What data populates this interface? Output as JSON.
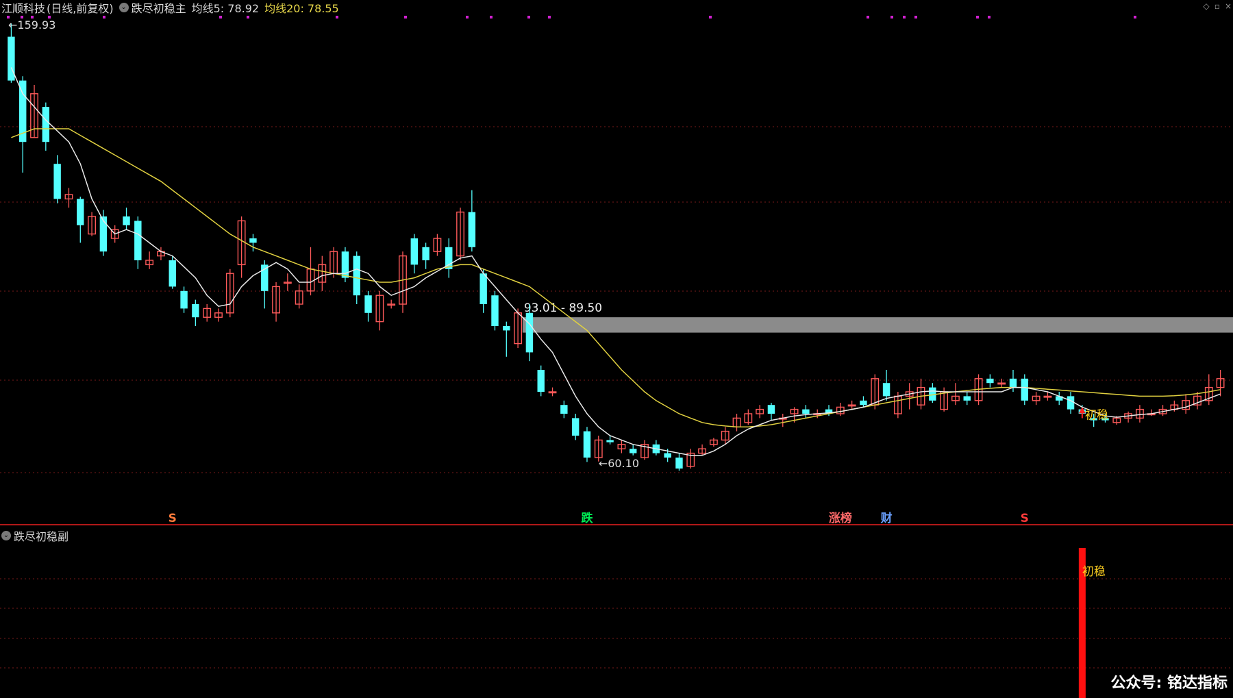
{
  "header": {
    "stock_name": "江顺科技",
    "period": "(日线,前复权)",
    "indicator_main": "跌尽初稳主",
    "ma5_label": "均线5: 78.92",
    "ma20_label": "均线20: 78.55"
  },
  "sub_header": {
    "indicator_sub": "跌尽初稳副"
  },
  "watermark": "公众号:  铭达指标",
  "colors": {
    "up": "#ff5a5a",
    "down": "#54ffff",
    "ma5": "#e8e8e8",
    "ma20": "#e0d040",
    "grid": "#7a1a1a",
    "zone": "#9a9a9a",
    "signal_dots": "#d020d0",
    "sub_bar": "#ff1010"
  },
  "icons": [
    "collapse-circle-icon",
    "diamond-icon",
    "window-icon",
    "close-icon"
  ],
  "chart_data": {
    "type": "candlestick",
    "price_range": [
      56,
      161
    ],
    "candles": [
      [
        157.0,
        147.0,
        160.0,
        146.5
      ],
      [
        147.0,
        133.0,
        148.0,
        126.0
      ],
      [
        134.0,
        144.0,
        146.0,
        134.0
      ],
      [
        141.0,
        133.0,
        142.0,
        131.0
      ],
      [
        128.0,
        120.0,
        130.0,
        119.0
      ],
      [
        120.0,
        121.0,
        122.5,
        118.0
      ],
      [
        120.0,
        114.0,
        120.5,
        110.0
      ],
      [
        112.0,
        116.0,
        117.0,
        111.5
      ],
      [
        116.0,
        108.0,
        117.5,
        107.0
      ],
      [
        111.0,
        113.0,
        114.0,
        110.0
      ],
      [
        116.0,
        114.0,
        118.0,
        113.0
      ],
      [
        115.0,
        106.0,
        116.0,
        104.0
      ],
      [
        105.0,
        106.0,
        108.0,
        104.0
      ],
      [
        107.0,
        108.0,
        109.0,
        106.0
      ],
      [
        106.0,
        100.0,
        107.0,
        99.5
      ],
      [
        99.0,
        95.0,
        100.0,
        94.0
      ],
      [
        96.0,
        93.0,
        97.0,
        91.0
      ],
      [
        93.0,
        95.0,
        96.0,
        92.0
      ],
      [
        93.0,
        94.0,
        95.0,
        92.0
      ],
      [
        94.0,
        103.0,
        104.0,
        93.0
      ],
      [
        105.0,
        115.0,
        116.0,
        102.0
      ],
      [
        111.0,
        110.0,
        112.0,
        108.0
      ],
      [
        105.0,
        99.0,
        106.0,
        95.0
      ],
      [
        94.0,
        100.0,
        101.0,
        92.0
      ],
      [
        101.0,
        101.0,
        103.0,
        99.0
      ],
      [
        96.0,
        99.0,
        100.5,
        95.0
      ],
      [
        99.0,
        104.0,
        109.0,
        98.0
      ],
      [
        101.0,
        105.0,
        107.0,
        99.0
      ],
      [
        103.0,
        108.0,
        109.0,
        102.0
      ],
      [
        108.0,
        102.0,
        109.0,
        101.0
      ],
      [
        107.0,
        98.0,
        108.0,
        96.0
      ],
      [
        98.0,
        94.0,
        99.0,
        92.0
      ],
      [
        92.0,
        98.0,
        99.0,
        90.0
      ],
      [
        96.0,
        96.0,
        97.0,
        95.0
      ],
      [
        96.0,
        107.0,
        108.0,
        94.0
      ],
      [
        111.0,
        105.0,
        112.0,
        103.0
      ],
      [
        109.0,
        106.0,
        110.0,
        104.0
      ],
      [
        108.0,
        111.0,
        112.0,
        107.0
      ],
      [
        109.0,
        104.0,
        111.0,
        102.0
      ],
      [
        107.0,
        117.0,
        118.0,
        106.0
      ],
      [
        117.0,
        109.0,
        122.0,
        108.0
      ],
      [
        103.0,
        96.0,
        104.0,
        94.0
      ],
      [
        98.0,
        91.0,
        99.0,
        90.0
      ],
      [
        91.0,
        90.0,
        92.0,
        84.0
      ],
      [
        87.0,
        94.0,
        95.0,
        86.0
      ],
      [
        94.0,
        85.0,
        96.0,
        83.0
      ],
      [
        81.0,
        76.0,
        82.0,
        75.0
      ],
      [
        76.0,
        76.0,
        77.0,
        75.0
      ],
      [
        73.0,
        71.0,
        74.0,
        70.0
      ],
      [
        70.0,
        66.0,
        71.0,
        65.0
      ],
      [
        67.0,
        61.0,
        68.0,
        60.0
      ],
      [
        61.0,
        65.0,
        66.0,
        60.1
      ],
      [
        65.0,
        64.5,
        66.0,
        64.0
      ],
      [
        63.0,
        64.0,
        65.0,
        62.0
      ],
      [
        63.0,
        62.0,
        64.0,
        61.5
      ],
      [
        61.0,
        64.0,
        65.0,
        60.5
      ],
      [
        64.0,
        62.0,
        65.0,
        61.5
      ],
      [
        62.0,
        61.0,
        63.0,
        60.0
      ],
      [
        61.0,
        58.5,
        62.0,
        58.0
      ],
      [
        59.0,
        62.0,
        63.0,
        58.5
      ],
      [
        62.0,
        63.0,
        64.0,
        61.5
      ],
      [
        64.0,
        65.0,
        65.5,
        63.5
      ],
      [
        65.0,
        67.0,
        68.0,
        64.0
      ],
      [
        68.0,
        70.0,
        71.0,
        67.0
      ],
      [
        69.0,
        71.0,
        72.0,
        68.5
      ],
      [
        71.0,
        72.0,
        73.0,
        70.0
      ],
      [
        73.0,
        71.0,
        73.5,
        69.5
      ],
      [
        70.0,
        70.0,
        71.0,
        68.0
      ],
      [
        71.0,
        72.0,
        72.5,
        69.0
      ],
      [
        72.0,
        71.0,
        73.0,
        70.0
      ],
      [
        71.0,
        71.0,
        72.0,
        70.0
      ],
      [
        72.0,
        71.0,
        73.0,
        70.5
      ],
      [
        71.0,
        72.5,
        73.5,
        70.5
      ],
      [
        73.0,
        73.0,
        74.0,
        72.0
      ],
      [
        74.0,
        73.0,
        75.0,
        72.5
      ],
      [
        73.0,
        79.0,
        80.0,
        72.0
      ],
      [
        78.0,
        75.0,
        81.0,
        74.0
      ],
      [
        71.0,
        75.0,
        76.0,
        70.0
      ],
      [
        75.0,
        76.0,
        78.0,
        72.0
      ],
      [
        73.0,
        77.0,
        79.0,
        72.0
      ],
      [
        77.0,
        74.0,
        78.0,
        73.5
      ],
      [
        72.0,
        76.0,
        77.0,
        71.5
      ],
      [
        74.0,
        75.0,
        78.0,
        73.0
      ],
      [
        75.0,
        74.0,
        76.0,
        73.0
      ],
      [
        74.0,
        79.0,
        80.0,
        73.0
      ],
      [
        79.0,
        78.0,
        80.0,
        77.0
      ],
      [
        78.0,
        78.0,
        79.0,
        77.0
      ],
      [
        79.0,
        77.0,
        81.0,
        76.0
      ],
      [
        79.0,
        74.0,
        80.0,
        73.0
      ],
      [
        74.0,
        75.0,
        76.0,
        73.0
      ],
      [
        75.0,
        75.0,
        76.0,
        74.0
      ],
      [
        75.0,
        74.0,
        76.0,
        73.0
      ],
      [
        75.0,
        72.0,
        76.0,
        71.0
      ],
      [
        72.0,
        71.0,
        73.0,
        70.0
      ],
      [
        70.0,
        69.5,
        71.0,
        68.0
      ],
      [
        70.0,
        69.5,
        71.0,
        69.0
      ],
      [
        69.0,
        70.0,
        70.5,
        68.5
      ],
      [
        70.0,
        71.0,
        71.5,
        69.0
      ],
      [
        70.0,
        72.0,
        73.0,
        69.0
      ],
      [
        71.0,
        71.0,
        72.0,
        70.5
      ],
      [
        71.0,
        72.0,
        73.0,
        70.5
      ],
      [
        72.0,
        73.0,
        74.0,
        71.5
      ],
      [
        72.0,
        74.0,
        75.5,
        71.0
      ],
      [
        73.0,
        75.0,
        76.0,
        72.0
      ],
      [
        74.0,
        77.0,
        80.0,
        73.0
      ],
      [
        77.0,
        79.0,
        81.0,
        75.0
      ]
    ],
    "ma5": [
      150.0,
      144.0,
      141.0,
      138.0,
      135.5,
      133.0,
      128.0,
      120.0,
      115.0,
      112.0,
      113.0,
      112.0,
      110.0,
      108.0,
      107.0,
      104.5,
      102.0,
      98.0,
      95.5,
      96.0,
      100.0,
      102.5,
      104.0,
      105.5,
      104.0,
      101.0,
      101.0,
      102.5,
      103.0,
      103.0,
      104.0,
      103.0,
      100.0,
      98.0,
      99.0,
      100.0,
      102.0,
      103.5,
      105.0,
      106.5,
      107.0,
      103.0,
      100.0,
      97.0,
      94.0,
      91.5,
      88.0,
      85.0,
      80.0,
      75.0,
      71.0,
      68.0,
      66.0,
      65.0,
      64.0,
      63.5,
      63.0,
      62.5,
      62.0,
      61.5,
      61.5,
      62.5,
      64.0,
      66.0,
      67.5,
      68.5,
      69.5,
      70.0,
      70.5,
      70.8,
      71.0,
      71.2,
      71.5,
      72.0,
      72.5,
      73.5,
      74.5,
      75.0,
      75.5,
      76.0,
      76.2,
      76.0,
      76.0,
      76.0,
      76.0,
      76.0,
      76.0,
      77.0,
      77.0,
      76.5,
      76.0,
      75.0,
      74.0,
      72.5,
      71.5,
      70.5,
      70.2,
      70.5,
      70.8,
      71.0,
      71.5,
      72.0,
      72.5,
      73.5,
      74.5,
      75.5
    ],
    "ma20": [
      134.0,
      135.0,
      136.0,
      136.0,
      136.0,
      136.0,
      134.5,
      133.0,
      131.5,
      130.0,
      128.5,
      127.0,
      125.5,
      124.0,
      122.0,
      120.0,
      118.0,
      116.0,
      114.0,
      112.0,
      110.5,
      109.0,
      108.0,
      107.0,
      106.0,
      105.0,
      104.0,
      103.5,
      103.0,
      102.5,
      102.0,
      101.5,
      101.0,
      101.0,
      101.5,
      102.0,
      103.0,
      104.0,
      104.5,
      105.0,
      105.0,
      104.0,
      103.0,
      102.0,
      101.0,
      100.0,
      98.0,
      96.0,
      94.0,
      92.0,
      90.0,
      87.0,
      84.0,
      81.0,
      78.5,
      76.0,
      74.0,
      72.5,
      71.0,
      70.0,
      69.0,
      68.5,
      68.2,
      68.0,
      68.0,
      68.2,
      68.5,
      69.0,
      69.5,
      70.0,
      70.5,
      71.0,
      71.5,
      72.0,
      72.5,
      73.0,
      73.5,
      74.0,
      74.5,
      75.0,
      75.3,
      75.7,
      76.0,
      76.3,
      76.6,
      76.8,
      77.0,
      77.0,
      77.0,
      76.8,
      76.6,
      76.4,
      76.2,
      76.0,
      75.8,
      75.6,
      75.4,
      75.2,
      75.0,
      75.0,
      75.0,
      75.1,
      75.3,
      75.6,
      76.0,
      76.5
    ],
    "annotations": {
      "high_label": "159.93",
      "low_label": "60.10",
      "zone_label": "93.01 - 89.50",
      "zone_range": [
        89.5,
        93.01
      ],
      "zone_start_index": 45,
      "low_index": 51,
      "signal_label": "初稳",
      "signal_index": 93
    },
    "markers": [
      {
        "text": "S",
        "index": 14,
        "color": "#ff7a3a"
      },
      {
        "text": "跌",
        "index": 50,
        "color": "#00ee55"
      },
      {
        "text": "涨榜",
        "index": 72,
        "color": "#ff6a6a"
      },
      {
        "text": "财",
        "index": 76,
        "color": "#6aa0ff"
      },
      {
        "text": "S",
        "index": 88,
        "color": "#ff3a3a"
      }
    ],
    "sub_signal": {
      "index": 93,
      "value": 1
    }
  }
}
